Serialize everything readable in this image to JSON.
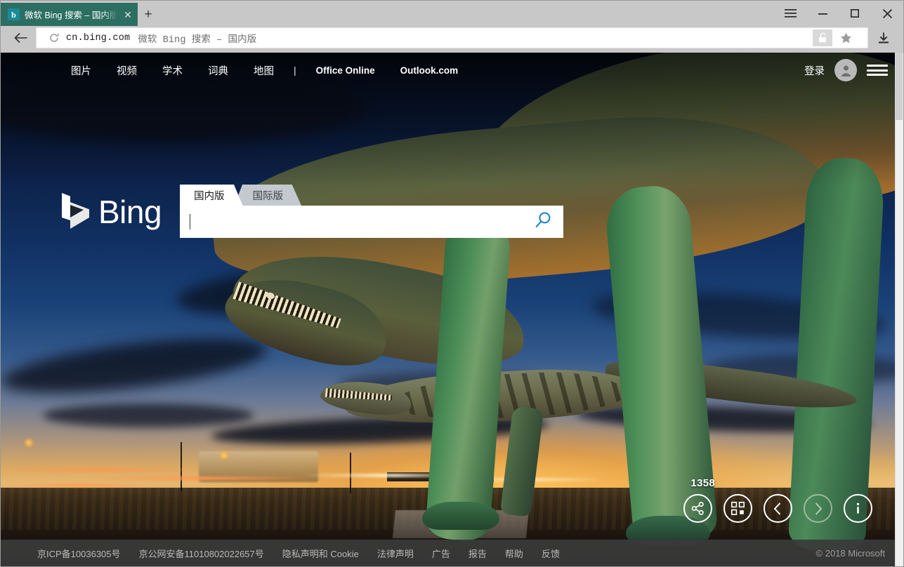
{
  "browser": {
    "tab": {
      "title": "微软 Bing 搜索 – 国内版",
      "favicon": "b",
      "close": "✕"
    },
    "newtab_label": "+",
    "window_controls": {
      "menu": "menu-icon",
      "minimize": "−",
      "maximize": "□",
      "close": "✕"
    },
    "toolbar": {
      "back": "back-arrow-icon",
      "reload": "reload-icon",
      "url_host": "cn.bing.com",
      "url_title": "微软 Bing 搜索 – 国内版",
      "lock": "unlocked-padlock-icon",
      "bookmark": "star-icon",
      "download": "download-icon"
    }
  },
  "bing": {
    "nav": [
      {
        "label": "图片",
        "style": "cn"
      },
      {
        "label": "视频",
        "style": "cn"
      },
      {
        "label": "学术",
        "style": "cn"
      },
      {
        "label": "词典",
        "style": "cn"
      },
      {
        "label": "地图",
        "style": "cn"
      },
      {
        "label": "|",
        "style": "sep"
      },
      {
        "label": "Office Online",
        "style": "en"
      },
      {
        "label": "Outlook.com",
        "style": "en"
      }
    ],
    "sign_in": "登录",
    "logo_text": "Bing",
    "market_tabs": [
      {
        "label": "国内版",
        "active": true
      },
      {
        "label": "国际版",
        "active": false
      }
    ],
    "search": {
      "value": "",
      "placeholder": ""
    },
    "image_controls": {
      "count": "1358",
      "buttons": [
        {
          "name": "share-icon",
          "dim": false
        },
        {
          "name": "qr-code-icon",
          "dim": false
        },
        {
          "name": "chevron-left-icon",
          "dim": false
        },
        {
          "name": "chevron-right-icon",
          "dim": true
        },
        {
          "name": "info-icon",
          "dim": false
        }
      ]
    },
    "footer": {
      "links": [
        "京ICP备10036305号",
        "京公网安备11010802022657号",
        "隐私声明和 Cookie",
        "法律声明",
        "广告",
        "报告",
        "帮助",
        "反馈"
      ],
      "copyright": "© 2018 Microsoft"
    }
  },
  "colors": {
    "tab_active": "#2c6e62",
    "chrome": "#c8c8c8",
    "search_accent": "#0b7cc1",
    "footer_bg": "#3a3a3a",
    "count_text": "#ffffff"
  }
}
